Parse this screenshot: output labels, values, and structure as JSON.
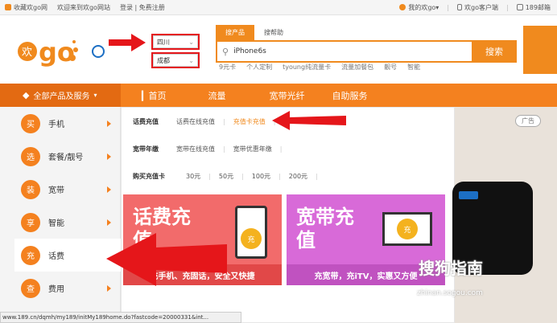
{
  "topbar": {
    "favorite": "收藏欢go网",
    "welcome": "欢迎来到欢go网站",
    "login_register": "登录 | 免费注册",
    "my_huango": "我的欢go▾",
    "client": "欢go客户端",
    "mail": "189邮箱"
  },
  "header": {
    "logo_text": "欢go",
    "province": "四川",
    "city": "成都",
    "search_tabs": [
      "搜产品",
      "搜帮助"
    ],
    "search_value": "iPhone6s",
    "search_button": "搜索",
    "hot_words": [
      "9元卡",
      "个人定制",
      "tyoung纯流量卡",
      "流量加餐包",
      "靓号",
      "智能"
    ]
  },
  "nav": {
    "all_categories": "全部产品及服务",
    "items": [
      "首页",
      "流量",
      "宽带光纤",
      "自助服务"
    ]
  },
  "sidebar": {
    "items": [
      {
        "icon": "买",
        "label": "手机"
      },
      {
        "icon": "选",
        "label": "套餐/靓号"
      },
      {
        "icon": "装",
        "label": "宽带"
      },
      {
        "icon": "享",
        "label": "智能"
      },
      {
        "icon": "充",
        "label": "话费"
      },
      {
        "icon": "查",
        "label": "费用"
      }
    ]
  },
  "panel": {
    "rows": [
      {
        "title": "话费充值",
        "links": [
          "话费在线充值",
          "充值卡充值"
        ]
      },
      {
        "title": "宽带年缴",
        "links": [
          "宽带在线充值",
          "宽带优惠年缴"
        ]
      },
      {
        "title": "购买充值卡",
        "links": [
          "30元",
          "50元",
          "100元",
          "200元"
        ]
      }
    ],
    "promo_left": {
      "title": "话费充值",
      "caption": "充手机、充固话，安全又快捷",
      "coin": "充"
    },
    "promo_right": {
      "title": "宽带充值",
      "caption": "充宽带，充iTV，实惠又方便",
      "coin": "充"
    }
  },
  "ad": {
    "tag": "广告"
  },
  "watermark": {
    "text": "搜狗指南",
    "url": "zhinan.sogou.com"
  },
  "status_url": "www.189.cn/dqmh/my189/initMy189home.do?fastcode=20000331&int...",
  "colors": {
    "orange": "#f4811f",
    "red_annotation": "#e5161a",
    "promo_left": "#f26b6b",
    "promo_right": "#d86ad8"
  }
}
